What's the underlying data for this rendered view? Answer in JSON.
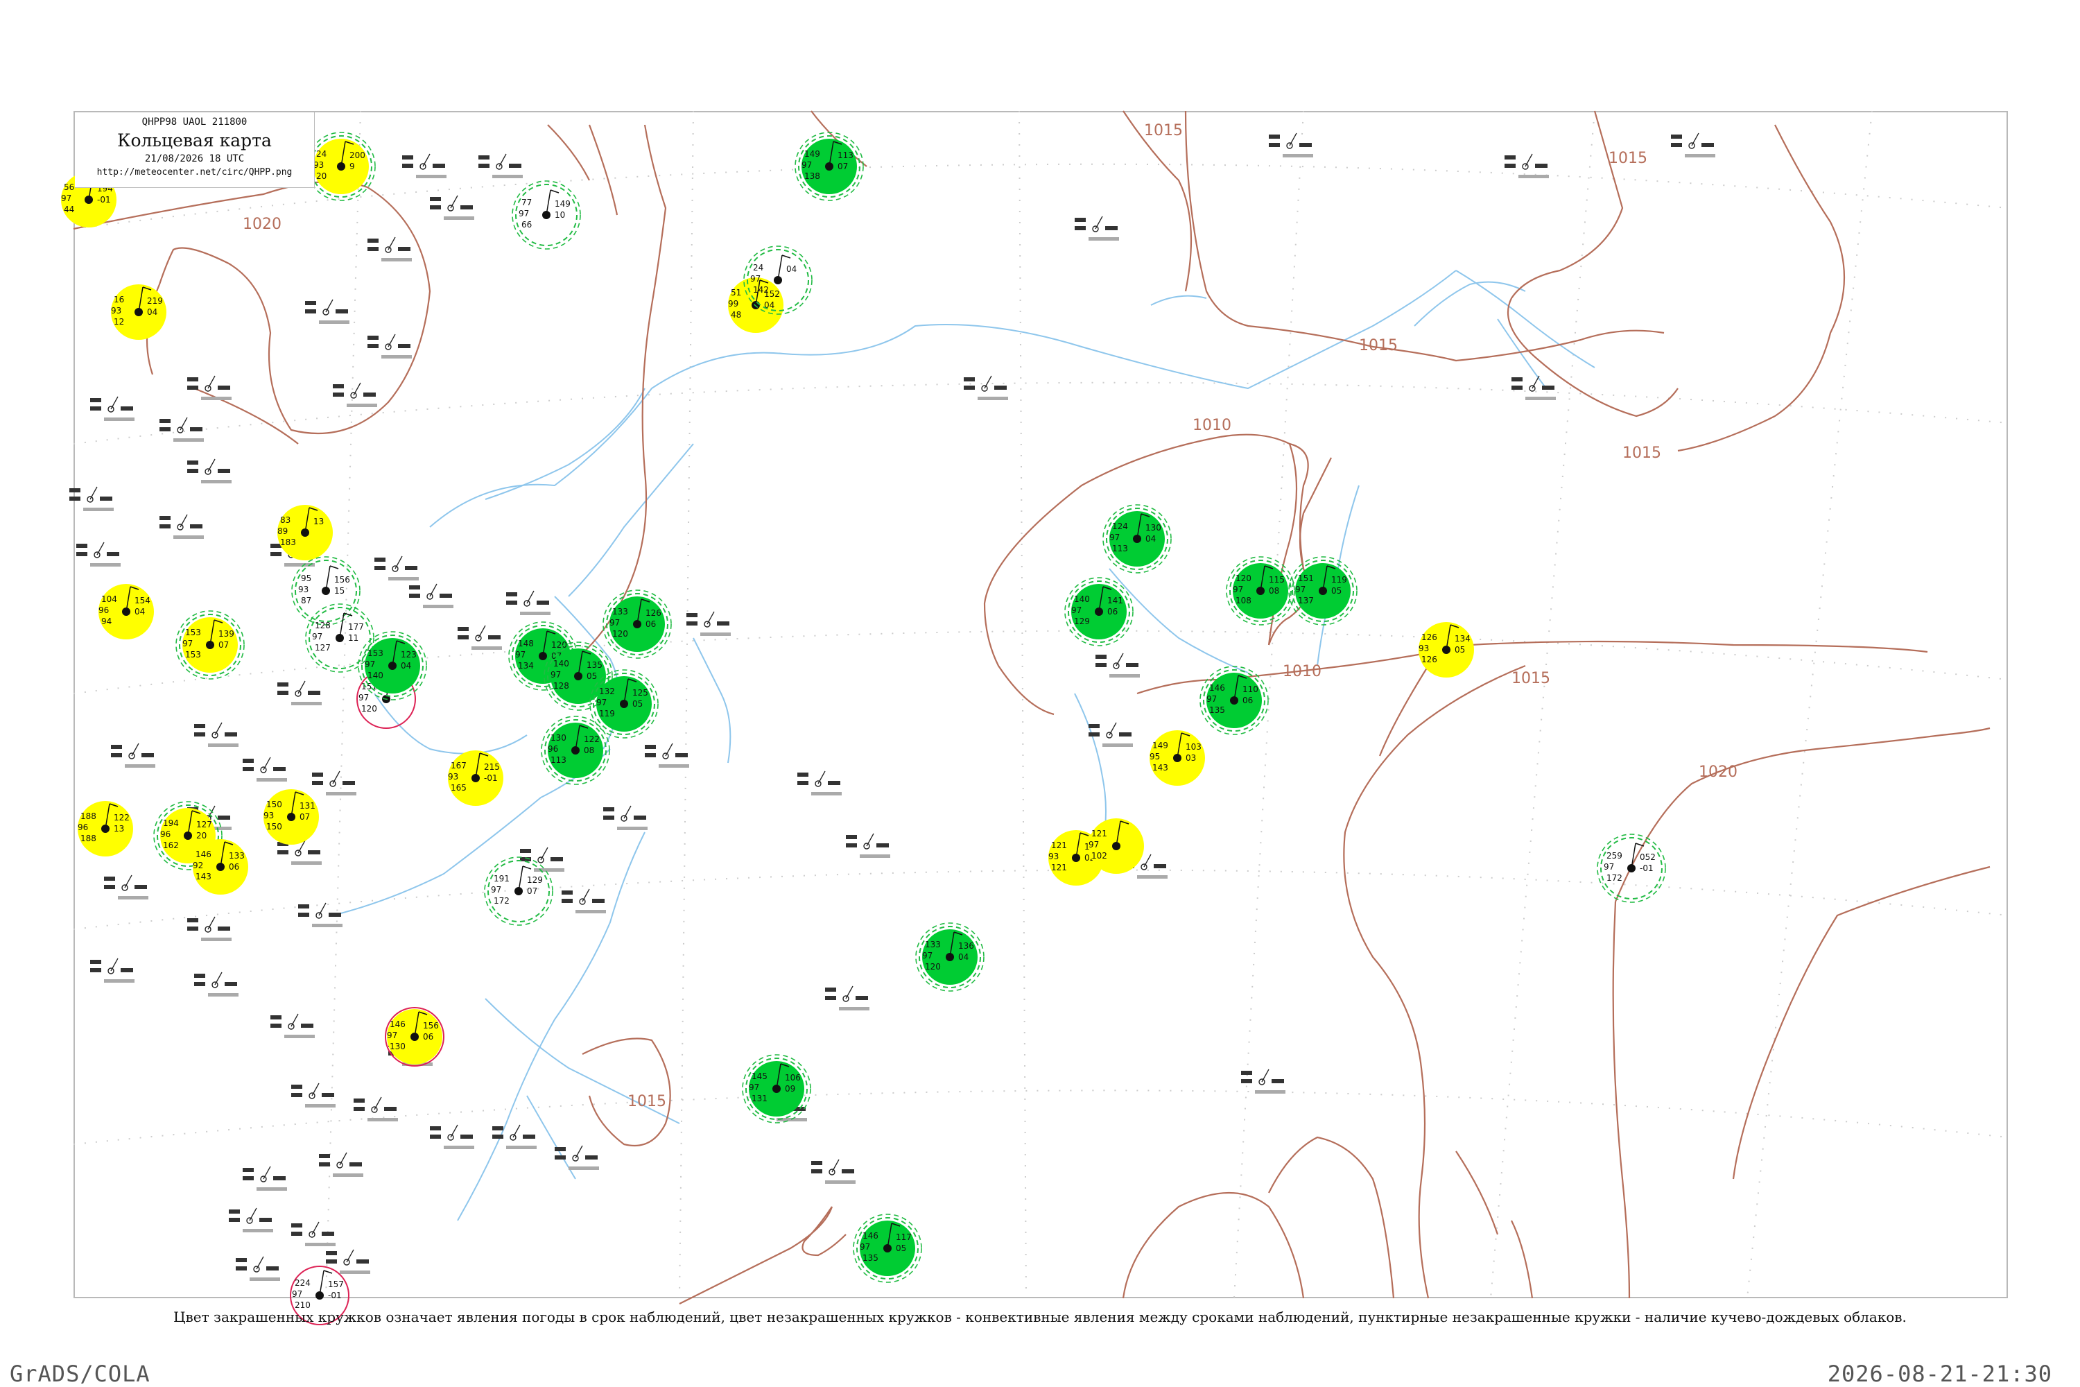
{
  "header": {
    "code_line": "QHPP98  UAOL  211800",
    "title": "Кольцевая карта",
    "date_line": "21/08/2026 18 UTC",
    "url": "http://meteocenter.net/circ/QHPP.png"
  },
  "footer": {
    "note": "Цвет закрашенных кружков означает явления погоды в срок наблюдений, цвет незакрашенных кружков - конвективные явления между сроками наблюдений, пунктирные незакрашенные кружки - наличие кучево-дождевых облаков.",
    "software": "GrADS/COLA",
    "timestamp": "2026-08-21-21:30"
  },
  "colors": {
    "isobar": "#b56e5a",
    "river": "#8ec6ec",
    "yellow_fill": "#ffff00",
    "green_fill": "#00cc33",
    "green_ring": "#22bb44",
    "pink_ring": "#dd2255",
    "grid_dot": "#cccccc"
  },
  "isobar_labels": [
    {
      "text": "1020"
    },
    {
      "text": "1015"
    },
    {
      "text": "1015"
    },
    {
      "text": "1015"
    },
    {
      "text": "1015"
    },
    {
      "text": "1010"
    },
    {
      "text": "1010"
    },
    {
      "text": "1015"
    },
    {
      "text": "1020"
    },
    {
      "text": "1015"
    }
  ],
  "stations": [
    {
      "values": [
        "56",
        "97",
        "44",
        "194",
        "-01"
      ],
      "fill": "yellow",
      "ring": "none"
    },
    {
      "values": [
        "24",
        "93",
        "20",
        "200",
        "9"
      ],
      "fill": "yellow",
      "ring": "green"
    },
    {
      "values": [
        "16",
        "93",
        "12",
        "219",
        "04"
      ],
      "fill": "yellow",
      "ring": "none"
    },
    {
      "values": [
        "51",
        "99",
        "48",
        "152",
        "04"
      ],
      "fill": "yellow",
      "ring": "none"
    },
    {
      "values": [
        "24",
        "97",
        "142",
        "04"
      ],
      "fill": "none",
      "ring": "green"
    },
    {
      "values": [
        "77",
        "97",
        "66",
        "149",
        "10"
      ],
      "fill": "none",
      "ring": "green"
    },
    {
      "values": [
        "83",
        "89",
        "183",
        "13"
      ],
      "fill": "yellow",
      "ring": "none"
    },
    {
      "values": [
        "95",
        "93",
        "87",
        "156",
        "15"
      ],
      "fill": "none",
      "ring": "green"
    },
    {
      "values": [
        "128",
        "97",
        "127",
        "177",
        "11"
      ],
      "fill": "none",
      "ring": "green"
    },
    {
      "values": [
        "104",
        "96",
        "94",
        "154",
        "04"
      ],
      "fill": "yellow",
      "ring": "none"
    },
    {
      "values": [
        "153",
        "97",
        "153",
        "139",
        "07"
      ],
      "fill": "yellow",
      "ring": "green"
    },
    {
      "values": [
        "151",
        "97",
        "120"
      ],
      "fill": "none",
      "ring": "pink"
    },
    {
      "values": [
        "167",
        "93",
        "165",
        "215",
        "-01"
      ],
      "fill": "yellow",
      "ring": "none"
    },
    {
      "values": [
        "150",
        "93",
        "150",
        "131",
        "07"
      ],
      "fill": "yellow",
      "ring": "none"
    },
    {
      "values": [
        "188",
        "96",
        "188",
        "122",
        "13"
      ],
      "fill": "yellow",
      "ring": "none"
    },
    {
      "values": [
        "194",
        "96",
        "162",
        "127",
        "20"
      ],
      "fill": "yellow",
      "ring": "green"
    },
    {
      "values": [
        "146",
        "92",
        "143",
        "133",
        "06"
      ],
      "fill": "yellow",
      "ring": "none"
    },
    {
      "values": [
        "191",
        "97",
        "172",
        "129",
        "07"
      ],
      "fill": "none",
      "ring": "green"
    },
    {
      "values": [
        "146",
        "97",
        "130",
        "156",
        "06"
      ],
      "fill": "yellow",
      "ring": "pink"
    },
    {
      "values": [
        "224",
        "97",
        "210",
        "157",
        "-01"
      ],
      "fill": "none",
      "ring": "pink"
    },
    {
      "values": [
        "126",
        "93",
        "126",
        "134",
        "05"
      ],
      "fill": "yellow",
      "ring": "none"
    },
    {
      "values": [
        "149",
        "95",
        "143",
        "103",
        "03"
      ],
      "fill": "yellow",
      "ring": "none"
    },
    {
      "values": [
        "121",
        "93",
        "121",
        "111",
        "02"
      ],
      "fill": "yellow",
      "ring": "none"
    },
    {
      "values": [
        "121",
        "97",
        "102"
      ],
      "fill": "yellow",
      "ring": "none"
    },
    {
      "values": [
        "259",
        "97",
        "172",
        "052",
        "-01"
      ],
      "fill": "none",
      "ring": "green"
    },
    {
      "values": [
        "153",
        "97",
        "140",
        "123",
        "04"
      ],
      "fill": "green",
      "ring": "green"
    },
    {
      "values": [
        "148",
        "97",
        "134",
        "120",
        "07"
      ],
      "fill": "green",
      "ring": "green"
    },
    {
      "values": [
        "140",
        "97",
        "128",
        "135",
        "05"
      ],
      "fill": "green",
      "ring": "green"
    },
    {
      "values": [
        "133",
        "97",
        "120",
        "126",
        "06"
      ],
      "fill": "green",
      "ring": "green"
    },
    {
      "values": [
        "130",
        "96",
        "113",
        "122",
        "08"
      ],
      "fill": "green",
      "ring": "green"
    },
    {
      "values": [
        "132",
        "97",
        "119",
        "125",
        "05"
      ],
      "fill": "green",
      "ring": "green"
    },
    {
      "values": [
        "124",
        "97",
        "113",
        "130",
        "04"
      ],
      "fill": "green",
      "ring": "green"
    },
    {
      "values": [
        "140",
        "97",
        "129",
        "141",
        "06"
      ],
      "fill": "green",
      "ring": "green"
    },
    {
      "values": [
        "120",
        "97",
        "108",
        "115",
        "08"
      ],
      "fill": "green",
      "ring": "green"
    },
    {
      "values": [
        "151",
        "97",
        "137",
        "119",
        "05"
      ],
      "fill": "green",
      "ring": "green"
    },
    {
      "values": [
        "146",
        "97",
        "135",
        "110",
        "06"
      ],
      "fill": "green",
      "ring": "green"
    },
    {
      "values": [
        "149",
        "97",
        "138",
        "113",
        "07"
      ],
      "fill": "green",
      "ring": "green"
    },
    {
      "values": [
        "146",
        "97",
        "135",
        "117",
        "05"
      ],
      "fill": "green",
      "ring": "green"
    },
    {
      "values": [
        "145",
        "97",
        "131",
        "106",
        "09"
      ],
      "fill": "green",
      "ring": "green"
    },
    {
      "values": [
        "133",
        "97",
        "120",
        "136",
        "04"
      ],
      "fill": "green",
      "ring": "green"
    }
  ]
}
